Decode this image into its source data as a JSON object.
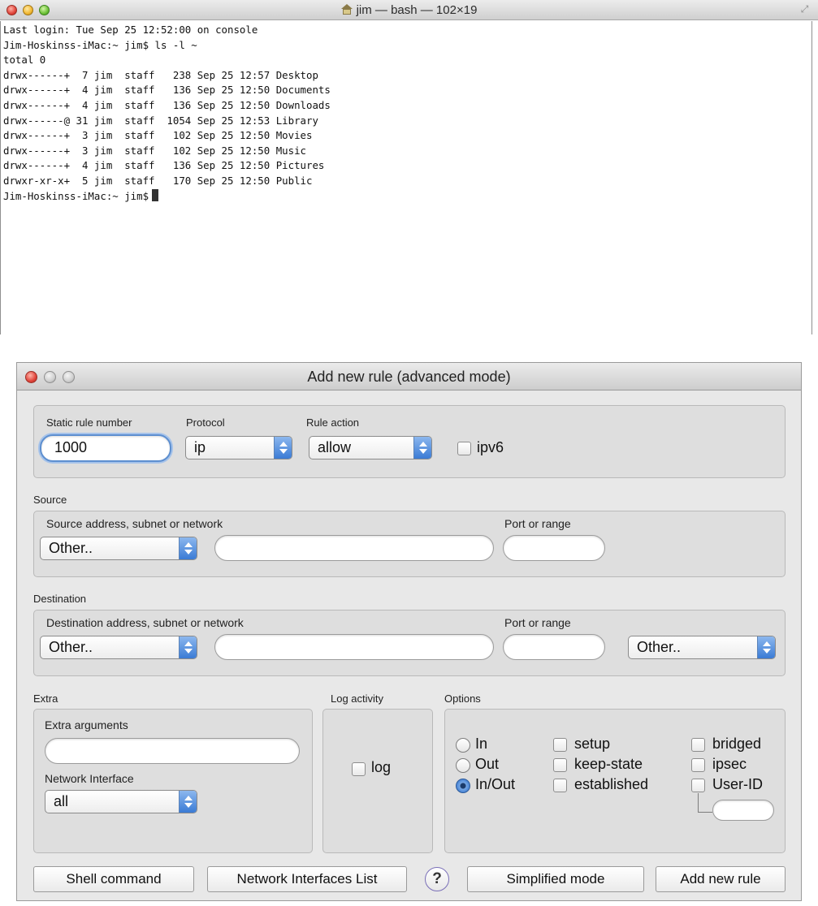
{
  "terminal": {
    "title": "jim — bash — 102×19",
    "lines": [
      "Last login: Tue Sep 25 12:52:00 on console",
      "Jim-Hoskinss-iMac:~ jim$ ls -l ~",
      "total 0",
      "drwx------+  7 jim  staff   238 Sep 25 12:57 Desktop",
      "drwx------+  4 jim  staff   136 Sep 25 12:50 Documents",
      "drwx------+  4 jim  staff   136 Sep 25 12:50 Downloads",
      "drwx------@ 31 jim  staff  1054 Sep 25 12:53 Library",
      "drwx------+  3 jim  staff   102 Sep 25 12:50 Movies",
      "drwx------+  3 jim  staff   102 Sep 25 12:50 Music",
      "drwx------+  4 jim  staff   136 Sep 25 12:50 Pictures",
      "drwxr-xr-x+  5 jim  staff   170 Sep 25 12:50 Public"
    ],
    "prompt": "Jim-Hoskinss-iMac:~ jim$"
  },
  "dialog": {
    "title": "Add new rule (advanced mode)",
    "rule": {
      "number_label": "Static rule number",
      "number_value": "1000",
      "protocol_label": "Protocol",
      "protocol_value": "ip",
      "action_label": "Rule action",
      "action_value": "allow",
      "ipv6_label": "ipv6"
    },
    "source": {
      "section_label": "Source",
      "address_label": "Source address, subnet or network",
      "address_type": "Other..",
      "address_value": "",
      "port_label": "Port or range",
      "port_value": ""
    },
    "destination": {
      "section_label": "Destination",
      "address_label": "Destination address, subnet or network",
      "address_type": "Other..",
      "address_value": "",
      "port_label": "Port or range",
      "port_value": "",
      "extra_select": "Other.."
    },
    "extra": {
      "section_label": "Extra",
      "args_label": "Extra arguments",
      "args_value": "",
      "interface_label": "Network Interface",
      "interface_value": "all"
    },
    "log": {
      "section_label": "Log activity",
      "log_label": "log"
    },
    "options": {
      "section_label": "Options",
      "direction": [
        "In",
        "Out",
        "In/Out"
      ],
      "direction_selected": "In/Out",
      "flags": [
        "setup",
        "keep-state",
        "established"
      ],
      "extras": [
        "bridged",
        "ipsec",
        "User-ID"
      ],
      "user_id_value": ""
    },
    "buttons": {
      "shell": "Shell command",
      "interfaces": "Network Interfaces List",
      "help": "?",
      "simplified": "Simplified mode",
      "add": "Add new rule"
    }
  },
  "colors": {
    "accent": "#3a7bd5",
    "close": "#e0443a",
    "minimize": "#f1b731",
    "maximize": "#6cc136",
    "dialog_bg": "#e8e8e8"
  },
  "icons": [
    "home-icon",
    "resize-icon",
    "close-icon",
    "minimize-icon",
    "zoom-icon",
    "popup-arrows-icon",
    "help-icon"
  ]
}
